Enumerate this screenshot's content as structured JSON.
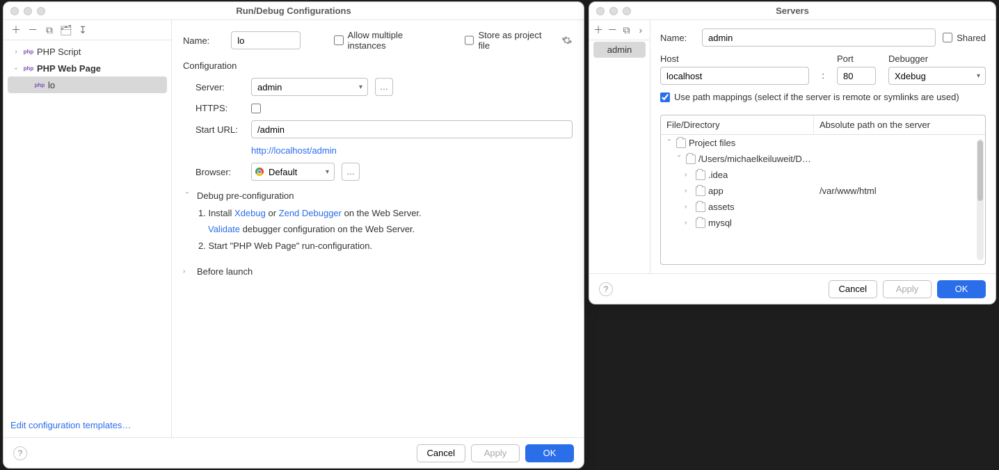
{
  "run_debug": {
    "title": "Run/Debug Configurations",
    "tree": {
      "php_script": "PHP Script",
      "php_web_page": "PHP Web Page",
      "child": "lo"
    },
    "footer_link": "Edit configuration templates…",
    "form": {
      "name_label": "Name:",
      "name_value": "lo",
      "allow_multiple": "Allow multiple instances",
      "store_as_project": "Store as project file",
      "section_config": "Configuration",
      "server_label": "Server:",
      "server_value": "admin",
      "https_label": "HTTPS:",
      "start_url_label": "Start URL:",
      "start_url_value": "/admin",
      "resolved_url": "http://localhost/admin",
      "browser_label": "Browser:",
      "browser_value": "Default",
      "debug_precfg": "Debug pre-configuration",
      "step1_prefix": "1. Install ",
      "xdebug": "Xdebug",
      "or": " or ",
      "zend": "Zend Debugger",
      "step1_suffix": " on the Web Server.",
      "validate": "Validate",
      "validate_suffix": " debugger configuration on the Web Server.",
      "step2": "2. Start \"PHP Web Page\" run-configuration.",
      "before_launch": "Before launch"
    },
    "buttons": {
      "cancel": "Cancel",
      "apply": "Apply",
      "ok": "OK"
    }
  },
  "servers": {
    "title": "Servers",
    "selected": "admin",
    "form": {
      "name_label": "Name:",
      "name_value": "admin",
      "shared": "Shared",
      "host_label": "Host",
      "host_value": "localhost",
      "port_label": "Port",
      "port_value": "80",
      "debugger_label": "Debugger",
      "debugger_value": "Xdebug",
      "use_path_mappings": "Use path mappings (select if the server is remote or symlinks are used)",
      "col_file": "File/Directory",
      "col_abs": "Absolute path on the server",
      "rows": {
        "project_files": "Project files",
        "user_path": "/Users/michaelkeiluweit/D…",
        "idea": ".idea",
        "app": "app",
        "app_remote": "/var/www/html",
        "assets": "assets",
        "mysql": "mysql"
      }
    },
    "buttons": {
      "cancel": "Cancel",
      "apply": "Apply",
      "ok": "OK"
    }
  }
}
